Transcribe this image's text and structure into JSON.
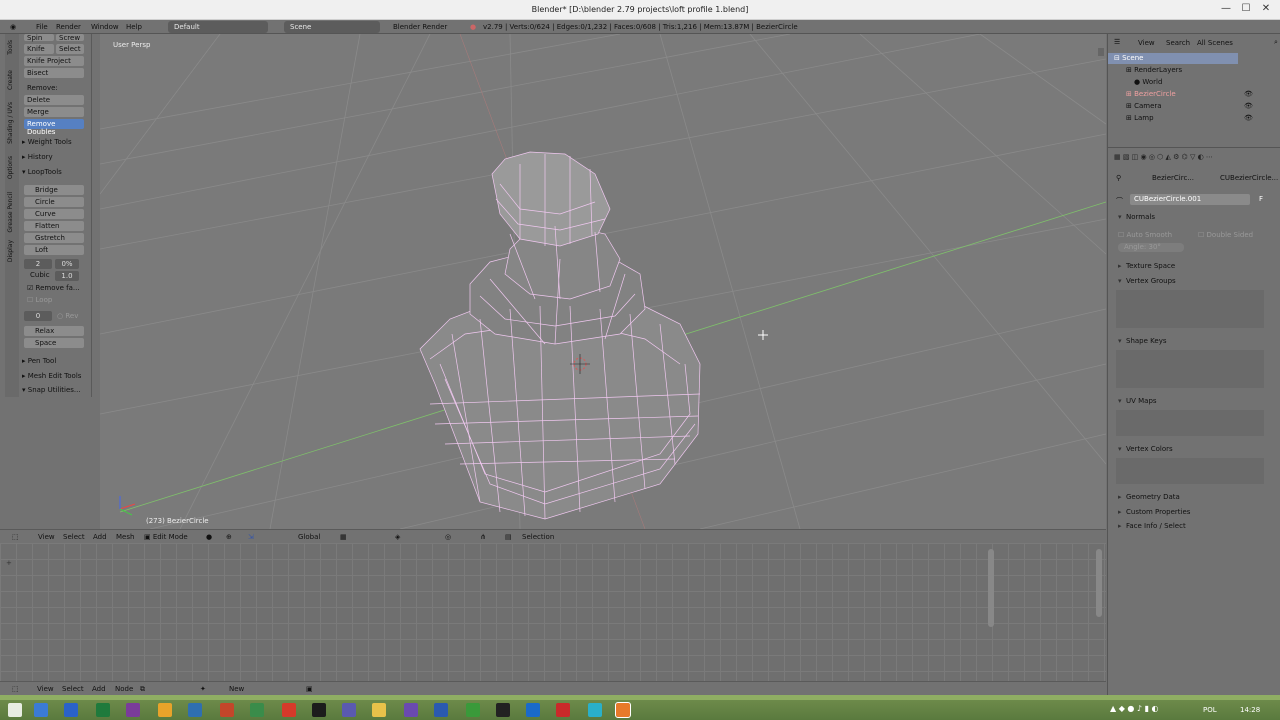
{
  "window": {
    "title": "Blender* [D:\\blender 2.79 projects\\loft profile 1.blend]",
    "controls": [
      "—",
      "☐",
      "✕"
    ]
  },
  "infobar": {
    "menus": [
      "File",
      "Render",
      "Window",
      "Help"
    ],
    "layout": "Default",
    "scene": "Scene",
    "engine": "Blender Render",
    "stats": "v2.79 | Verts:0/624 | Edges:0/1,232 | Faces:0/608 | Tris:1,216 | Mem:13.87M | BezierCircle"
  },
  "toolshelf": {
    "tabs": [
      "Tools",
      "Create",
      "Shading / UVs",
      "Options",
      "Grease Pencil",
      "Display"
    ],
    "top_buttons": [
      [
        "Spin",
        "Screw"
      ],
      [
        "Knife",
        "Select"
      ]
    ],
    "buttons1": [
      "Knife Project",
      "Bisect"
    ],
    "remove_label": "Remove:",
    "remove_buttons": [
      "Delete",
      "Merge",
      "Remove Doubles"
    ],
    "panels_collapsed": [
      "Weight Tools",
      "History"
    ],
    "looptools_header": "LoopTools",
    "looptools_items": [
      "Bridge",
      "Circle",
      "Curve",
      "Flatten",
      "Gstretch",
      "Loft"
    ],
    "loft_fields": {
      "segments": "2",
      "strength": "0%",
      "interp": "Cubic",
      "interp_val": "1.0",
      "remove_faces": "Remove fa...",
      "loop": "Loop",
      "twist": "0",
      "rev": "Rev"
    },
    "more_items": [
      "Relax",
      "Space"
    ],
    "bottom_panels": [
      "Pen Tool",
      "Mesh Edit Tools",
      "Snap Utilities..."
    ]
  },
  "viewport": {
    "view_label": "User Persp",
    "object_label": "(273) BezierCircle"
  },
  "view3d_header": {
    "menus": [
      "View",
      "Select",
      "Add",
      "Mesh"
    ],
    "mode": "Edit Mode",
    "orientation": "Global",
    "selection": "Selection"
  },
  "node_header": {
    "menus": [
      "View",
      "Select",
      "Add",
      "Node"
    ],
    "new_button": "New"
  },
  "outliner": {
    "menus": [
      "View",
      "Search",
      "All Scenes"
    ],
    "items": [
      "Scene",
      "RenderLayers",
      "World",
      "BezierCircle",
      "Camera",
      "Lamp"
    ]
  },
  "properties": {
    "breadcrumb": [
      "BezierCirc...",
      "CUBezierCircle..."
    ],
    "datablock": "CUBezierCircle.001",
    "fake_user": "F",
    "normals_header": "Normals",
    "auto_smooth": "Auto Smooth",
    "double_sided": "Double Sided",
    "angle": "Angle:",
    "angle_val": "30°",
    "sections": [
      "Texture Space",
      "Vertex Groups",
      "Shape Keys",
      "UV Maps",
      "Vertex Colors",
      "Geometry Data",
      "Custom Properties",
      "Face Info / Select"
    ]
  },
  "taskbar": {
    "lang": "POL",
    "time": "14:28"
  }
}
